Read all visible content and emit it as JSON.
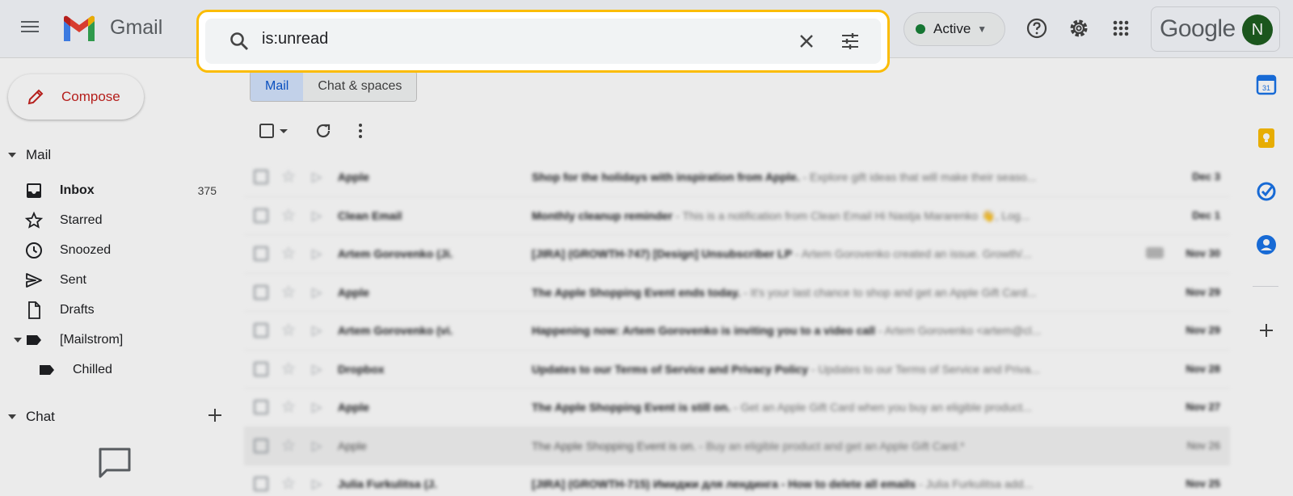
{
  "app": {
    "logo_text": "Gmail",
    "google_text": "Google",
    "avatar_initial": "N"
  },
  "status": {
    "label": "Active",
    "color": "#188038"
  },
  "search": {
    "query": "is:unread"
  },
  "compose": {
    "label": "Compose"
  },
  "sidebar": {
    "mail_header": "Mail",
    "items": [
      {
        "label": "Inbox",
        "count": "375",
        "icon": "inbox-icon"
      },
      {
        "label": "Starred",
        "icon": "star-icon"
      },
      {
        "label": "Snoozed",
        "icon": "clock-icon"
      },
      {
        "label": "Sent",
        "icon": "send-icon"
      },
      {
        "label": "Drafts",
        "icon": "draft-icon"
      },
      {
        "label": "[Mailstrom]",
        "icon": "label-icon"
      },
      {
        "label": "Chilled",
        "icon": "label-icon"
      }
    ],
    "chat_header": "Chat"
  },
  "tabs": [
    {
      "label": "Mail",
      "selected": true
    },
    {
      "label": "Chat & spaces",
      "selected": false
    }
  ],
  "emails": [
    {
      "sender": "Apple",
      "subject": "Shop for the holidays with inspiration from Apple.",
      "snippet": " - Explore gift ideas that will make their seaso...",
      "date": "Dec 3",
      "unread": true
    },
    {
      "sender": "Clean Email",
      "subject": "Monthly cleanup reminder",
      "snippet": " - This is a notification from Clean Email Hi Nastja Mararenko 👋, Log...",
      "date": "Dec 1",
      "unread": true
    },
    {
      "sender": "Artem Gorovenko (Ji.",
      "subject": "[JIRA] (GROWTH-747) [Design] Unsubscriber LP",
      "snippet": " - Artem Gorovenko created an issue. Growth/...",
      "date": "Nov 30",
      "unread": true
    },
    {
      "sender": "Apple",
      "subject": "The Apple Shopping Event ends today.",
      "snippet": " - It's your last chance to shop and get an Apple Gift Card...",
      "date": "Nov 29",
      "unread": true
    },
    {
      "sender": "Artem Gorovenko (vi.",
      "subject": "Happening now: Artem Gorovenko is inviting you to a video call",
      "snippet": " - Artem Gorovenko <artem@cl...",
      "date": "Nov 29",
      "unread": true
    },
    {
      "sender": "Dropbox",
      "subject": "Updates to our Terms of Service and Privacy Policy",
      "snippet": " - Updates to our Terms of Service and Priva...",
      "date": "Nov 28",
      "unread": true
    },
    {
      "sender": "Apple",
      "subject": "The Apple Shopping Event is still on.",
      "snippet": " - Get an Apple Gift Card when you buy an eligible product...",
      "date": "Nov 27",
      "unread": true
    },
    {
      "sender": "Apple",
      "subject": "The Apple Shopping Event is on.",
      "snippet": " - Buy an eligible product and get an Apple Gift Card.*",
      "date": "Nov 26",
      "unread": false
    },
    {
      "sender": "Julia Furkulitsa (J.",
      "subject": "[JIRA] (GROWTH-715) Имиджи для лендинга - How to delete all emails",
      "snippet": " - Julia Furkulitsa add...",
      "date": "Nov 25",
      "unread": true
    }
  ]
}
